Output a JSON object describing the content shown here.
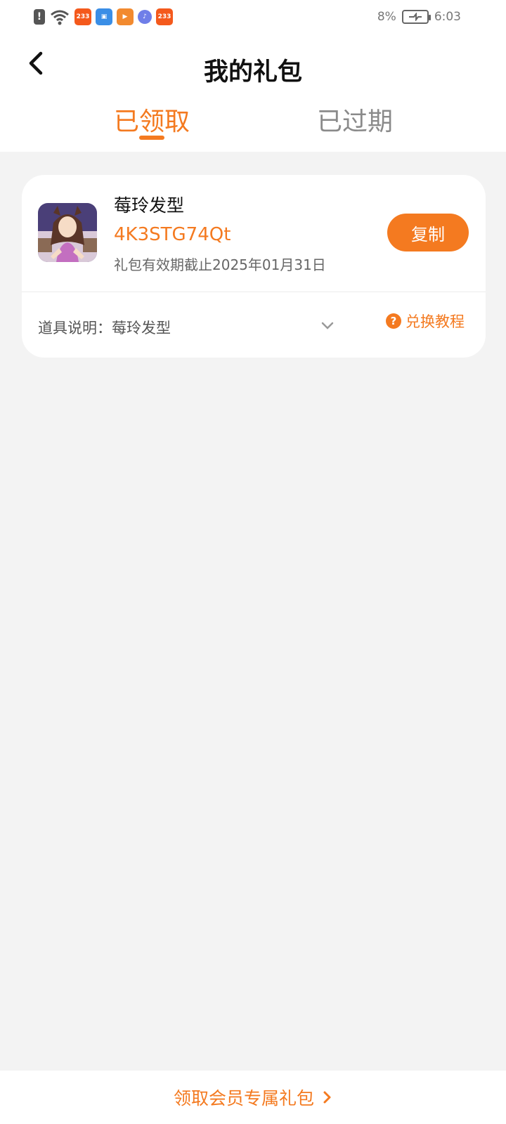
{
  "status_bar": {
    "battery_percent": "8%",
    "time": "6:03",
    "app_badge_233": "233"
  },
  "header": {
    "title": "我的礼包"
  },
  "tabs": [
    {
      "label": "已领取",
      "active": true
    },
    {
      "label": "已过期",
      "active": false
    }
  ],
  "gift": {
    "name": "莓玲发型",
    "code": "4K3STG74Qt",
    "expiry": "礼包有效期截止2025年01月31日",
    "copy_label": "复制",
    "prop_description": "道具说明：莓玲发型",
    "tutorial_label": "兑换教程"
  },
  "footer": {
    "label": "领取会员专属礼包"
  },
  "colors": {
    "accent": "#f47a20",
    "background": "#f3f3f3",
    "card": "#ffffff"
  }
}
